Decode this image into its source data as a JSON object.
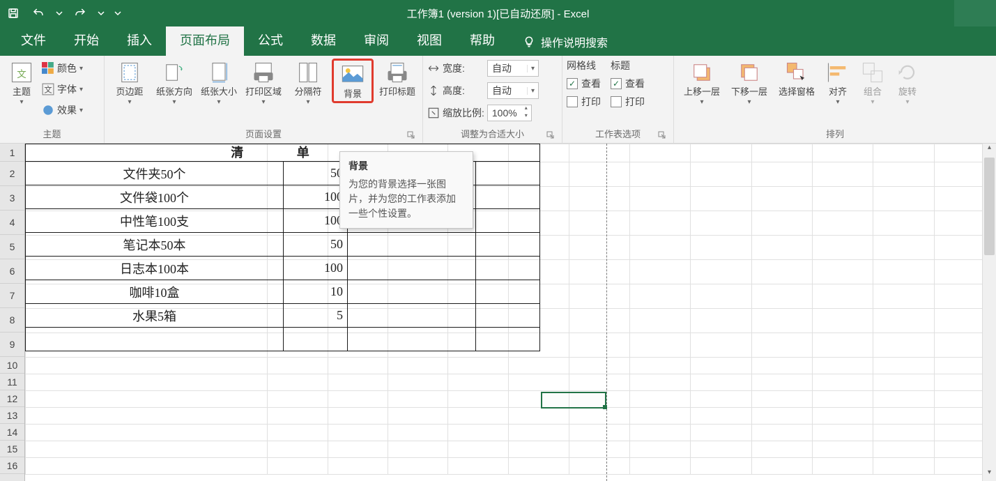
{
  "app_title": "工作簿1 (version 1)[已自动还原]  -  Excel",
  "qat": {
    "save": "保存",
    "undo": "撤销",
    "redo": "重做",
    "customize": "自定义"
  },
  "tabs": {
    "file": "文件",
    "home": "开始",
    "insert": "插入",
    "page_layout": "页面布局",
    "formulas": "公式",
    "data": "数据",
    "review": "审阅",
    "view": "视图",
    "help": "帮助"
  },
  "tell_me": "操作说明搜索",
  "groups": {
    "themes": {
      "label": "主题",
      "theme": "主题",
      "colors": "颜色",
      "fonts": "字体",
      "effects": "效果"
    },
    "page_setup": {
      "label": "页面设置",
      "margins": "页边距",
      "orientation": "纸张方向",
      "size": "纸张大小",
      "print_area": "打印区域",
      "breaks": "分隔符",
      "background": "背景",
      "print_titles": "打印标题"
    },
    "scale": {
      "label": "调整为合适大小",
      "width": "宽度:",
      "height": "高度:",
      "scale": "缩放比例:",
      "width_val": "自动",
      "height_val": "自动",
      "scale_val": "100%"
    },
    "sheet_options": {
      "label": "工作表选项",
      "gridlines": "网格线",
      "headings": "标题",
      "view": "查看",
      "print": "打印"
    },
    "arrange": {
      "label": "排列",
      "bring_forward": "上移一层",
      "send_backward": "下移一层",
      "selection_pane": "选择窗格",
      "align": "对齐",
      "group": "组合",
      "rotate": "旋转"
    }
  },
  "tooltip": {
    "title": "背景",
    "body": "为您的背景选择一张图片，并为您的工作表添加一些个性设置。"
  },
  "table": {
    "heading": "清    单",
    "rows": [
      {
        "item": "文件夹50个",
        "qty": "50"
      },
      {
        "item": "文件袋100个",
        "qty": "100"
      },
      {
        "item": "中性笔100支",
        "qty": "100"
      },
      {
        "item": "笔记本50本",
        "qty": "50"
      },
      {
        "item": "日志本100本",
        "qty": "100"
      },
      {
        "item": "咖啡10盒",
        "qty": "10"
      },
      {
        "item": "水果5箱",
        "qty": "5"
      }
    ]
  },
  "row_numbers": [
    "1",
    "2",
    "3",
    "4",
    "5",
    "6",
    "7",
    "8",
    "9",
    "10",
    "11",
    "12",
    "13",
    "14",
    "15",
    "16"
  ]
}
